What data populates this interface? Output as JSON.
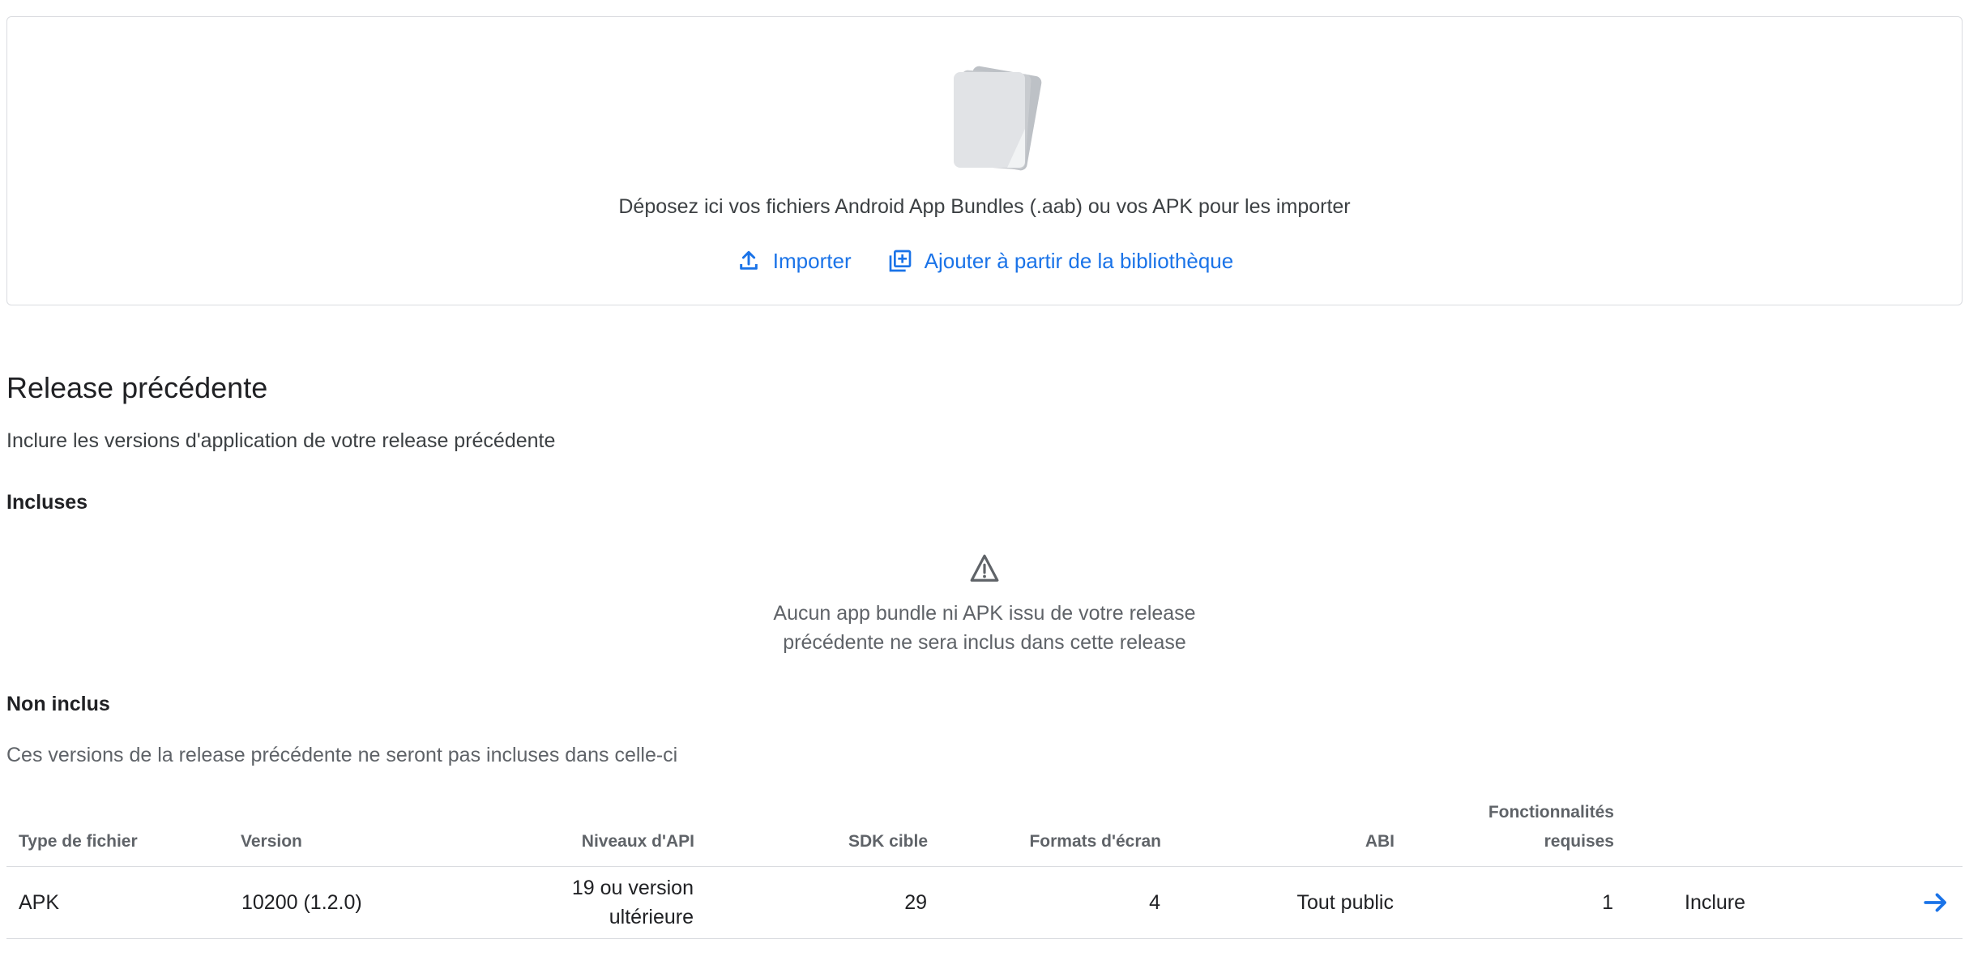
{
  "dropzone": {
    "message": "Déposez ici vos fichiers Android App Bundles (.aab) ou vos APK pour les importer",
    "import_label": "Importer",
    "library_label": "Ajouter à partir de la bibliothèque",
    "illustration_icon": "file-stack-icon",
    "import_icon": "upload-icon",
    "library_icon": "library-add-icon"
  },
  "previous_release": {
    "title": "Release précédente",
    "subtitle": "Inclure les versions d'application de votre release précédente",
    "included_heading": "Incluses",
    "empty_icon": "warning-icon",
    "empty_line1": "Aucun app bundle ni APK issu de votre release",
    "empty_line2": "précédente ne sera inclus dans cette release",
    "not_included_heading": "Non inclus",
    "not_included_description": "Ces versions de la release précédente ne seront pas incluses dans celle-ci"
  },
  "table": {
    "headers": {
      "file_type": "Type de fichier",
      "version": "Version",
      "api_levels": "Niveaux d'API",
      "target_sdk": "SDK cible",
      "screen_formats": "Formats d'écran",
      "abi": "ABI",
      "features_line1": "Fonctionnalités",
      "features_line2": "requises"
    },
    "rows": [
      {
        "file_type": "APK",
        "version": "10200 (1.2.0)",
        "api_line1": "19 ou version",
        "api_line2": "ultérieure",
        "target_sdk": "29",
        "screen_formats": "4",
        "abi": "Tout public",
        "features": "1",
        "action": "Inclure",
        "arrow_icon": "arrow-forward-icon"
      }
    ]
  },
  "colors": {
    "accent": "#1a73e8",
    "border": "#dadce0",
    "text_primary": "#202124",
    "text_secondary": "#5f6368"
  }
}
